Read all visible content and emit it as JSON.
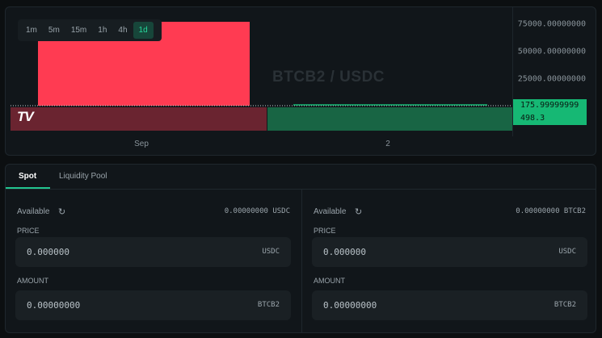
{
  "chart": {
    "timeframes": [
      "1m",
      "5m",
      "15m",
      "1h",
      "4h",
      "1d"
    ],
    "active_timeframe": "1d",
    "pair_watermark": "BTCB2 / USDC",
    "logo_text": "TV",
    "price_ticks": [
      "75000.00000000",
      "50000.00000000",
      "25000.00000000"
    ],
    "last_price_tag": "175.99999999",
    "volume_tag": "498.3",
    "time_labels": [
      "Sep",
      "2"
    ],
    "colors": {
      "up": "#16b874",
      "down": "#ff3b52",
      "background": "#11161a"
    }
  },
  "tabs": {
    "spot": "Spot",
    "liquidity_pool": "Liquidity Pool",
    "active": "Spot"
  },
  "buy_form": {
    "available_label": "Available",
    "available_value": "0.00000000 USDC",
    "price_label": "PRICE",
    "price_value": "0.000000",
    "price_unit": "USDC",
    "amount_label": "AMOUNT",
    "amount_value": "0.00000000",
    "amount_unit": "BTCB2"
  },
  "sell_form": {
    "available_label": "Available",
    "available_value": "0.00000000 BTCB2",
    "price_label": "PRICE",
    "price_value": "0.000000",
    "price_unit": "USDC",
    "amount_label": "AMOUNT",
    "amount_value": "0.00000000",
    "amount_unit": "BTCB2"
  },
  "icons": {
    "refresh": "refresh-icon"
  }
}
